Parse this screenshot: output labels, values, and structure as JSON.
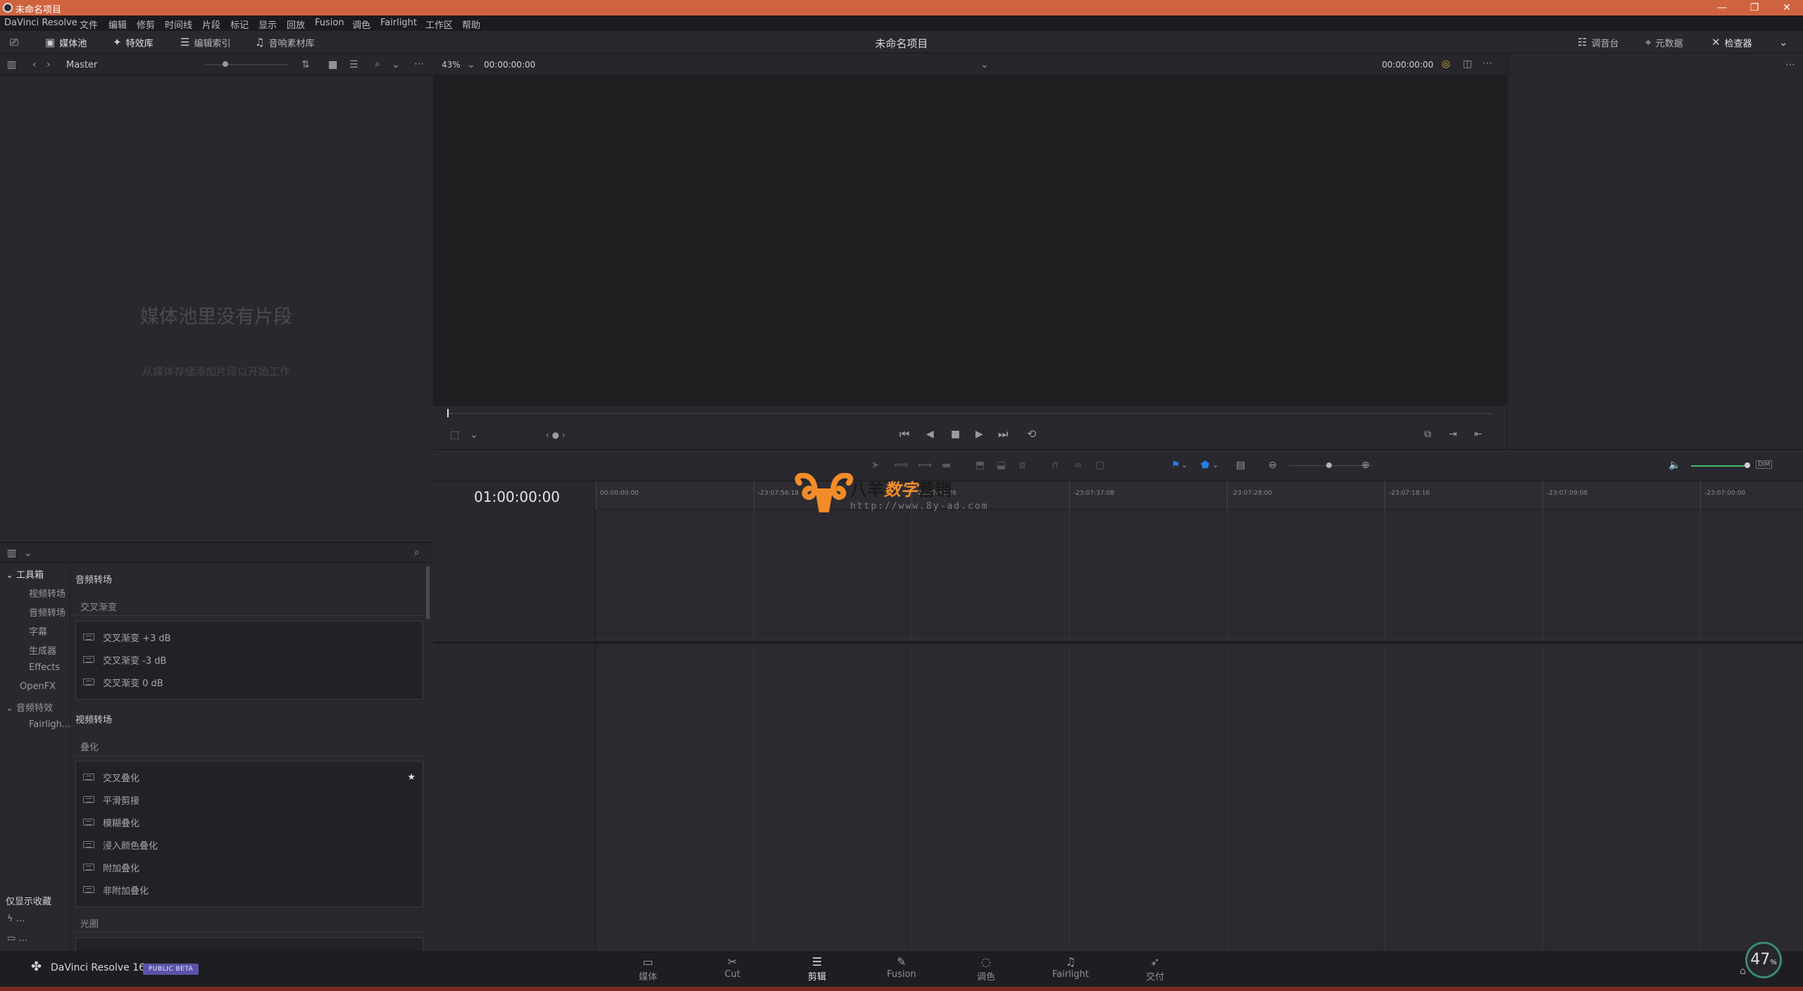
{
  "window": {
    "title": "未命名项目",
    "minimize": "—",
    "maximize": "❐",
    "close": "✕"
  },
  "menu": [
    "DaVinci Resolve",
    "文件",
    "编辑",
    "修剪",
    "时间线",
    "片段",
    "标记",
    "显示",
    "回放",
    "Fusion",
    "调色",
    "Fairlight",
    "工作区",
    "帮助"
  ],
  "toolbar": {
    "media_pool": "媒体池",
    "effects_library": "特效库",
    "edit_index": "编辑索引",
    "sound_library": "音响素材库",
    "project_title": "未命名项目",
    "mixer": "调音台",
    "metadata": "元数据",
    "inspector": "检查器"
  },
  "media_pool": {
    "bin": "Master",
    "empty_title": "媒体池里没有片段",
    "empty_subtitle": "从媒体存储添加片段以开始工作"
  },
  "effects_tree": [
    {
      "label": "工具箱",
      "level": 0,
      "expanded": true,
      "selected": true
    },
    {
      "label": "视频转场",
      "level": 1
    },
    {
      "label": "音频转场",
      "level": 1
    },
    {
      "label": "字幕",
      "level": 1
    },
    {
      "label": "生成器",
      "level": 1
    },
    {
      "label": "Effects",
      "level": 1
    },
    {
      "label": "OpenFX",
      "level": 0
    },
    {
      "label": "音频特效",
      "level": 0,
      "expanded": true
    },
    {
      "label": "Fairligh...",
      "level": 1
    }
  ],
  "favorites": {
    "label": "仅显示收藏",
    "item1": "...",
    "item2": "..."
  },
  "effects_list": {
    "audio_section": "音频转场",
    "audio_sub": "交叉渐变",
    "audio_items": [
      "交叉渐变 +3 dB",
      "交叉渐变 -3 dB",
      "交叉渐变 0 dB"
    ],
    "video_section": "视频转场",
    "video_sub": "叠化",
    "video_items": [
      "交叉叠化",
      "平滑剪接",
      "模糊叠化",
      "浸入颜色叠化",
      "附加叠化",
      "非附加叠化"
    ],
    "iris_sub": "光圈"
  },
  "viewer": {
    "zoom": "43%",
    "source_timecode": "00:00:00:00",
    "program_timecode": "00:00:00:00"
  },
  "timeline": {
    "timecode": "01:00:00:00",
    "ruler": [
      "00:00:00:00",
      "-23:07:56:18",
      "-23:07:46:26",
      "-23:07:37:08",
      "-23:07:28:00",
      "-23:07:18:16",
      "-23:07:09:08",
      "-23:07:00:00"
    ],
    "dim_label": "DIM"
  },
  "pages": [
    {
      "label": "媒体",
      "icon": "media-page-icon",
      "glyph": "▭"
    },
    {
      "label": "Cut",
      "icon": "cut-page-icon",
      "glyph": "✂"
    },
    {
      "label": "剪辑",
      "icon": "edit-page-icon",
      "glyph": "☰",
      "active": true
    },
    {
      "label": "Fusion",
      "icon": "fusion-page-icon",
      "glyph": "✎"
    },
    {
      "label": "调色",
      "icon": "color-page-icon",
      "glyph": "◌"
    },
    {
      "label": "Fairlight",
      "icon": "fairlight-page-icon",
      "glyph": "♫"
    },
    {
      "label": "交付",
      "icon": "deliver-page-icon",
      "glyph": "➶"
    }
  ],
  "brand": {
    "name": "DaVinci Resolve 16",
    "badge": "PUBLIC BETA"
  },
  "perf": {
    "value": "47",
    "unit": "%"
  },
  "watermark": {
    "cn1": "八羊",
    "cn2": "数字",
    "cn3": "营销",
    "url": "http://www.8y-ad.com"
  },
  "colors": {
    "title_bar": "#d0633f",
    "accent_active": "#e0483a",
    "badge": "#5a53a8",
    "flag_blue": "#2b7de0",
    "volume_green": "#3cbf6a"
  }
}
